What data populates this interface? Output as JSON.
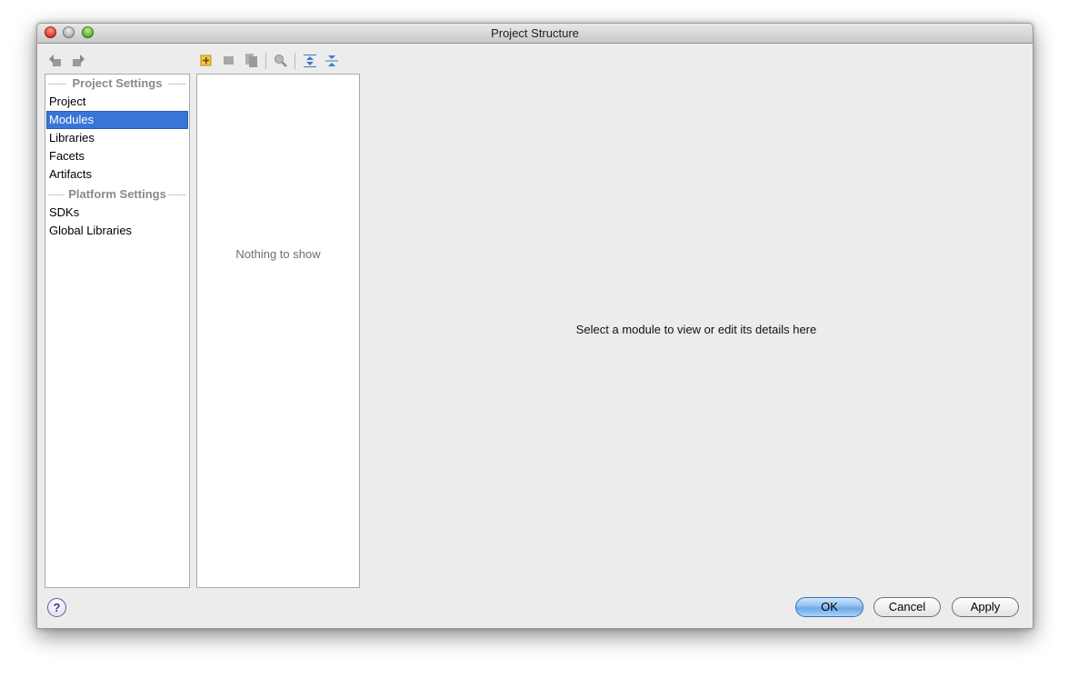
{
  "window": {
    "title": "Project Structure"
  },
  "toolbar": {
    "nav_icons": [
      "back-arrow-icon",
      "forward-arrow-icon"
    ],
    "tree_icons": [
      "add-icon",
      "remove-icon",
      "copy-icon",
      "search-icon",
      "expand-all-icon",
      "collapse-all-icon"
    ]
  },
  "sidebar": {
    "project_settings_header": "Project Settings",
    "project_items": [
      {
        "label": "Project",
        "selected": false
      },
      {
        "label": "Modules",
        "selected": true
      },
      {
        "label": "Libraries",
        "selected": false
      },
      {
        "label": "Facets",
        "selected": false
      },
      {
        "label": "Artifacts",
        "selected": false
      }
    ],
    "platform_settings_header": "Platform Settings",
    "platform_items": [
      {
        "label": "SDKs",
        "selected": false
      },
      {
        "label": "Global Libraries",
        "selected": false
      }
    ]
  },
  "module_list": {
    "empty_text": "Nothing to show"
  },
  "details": {
    "placeholder_text": "Select a module to view or edit its details here"
  },
  "footer": {
    "help_label": "?",
    "ok_label": "OK",
    "cancel_label": "Cancel",
    "apply_label": "Apply"
  },
  "colors": {
    "selection": "#3875d7",
    "window_bg": "#ececec",
    "default_button": "#8fc0f0"
  }
}
